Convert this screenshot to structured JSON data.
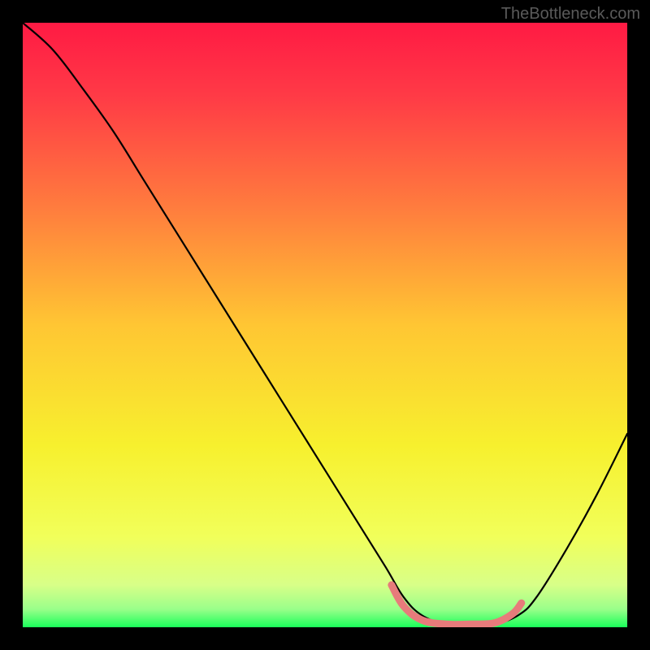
{
  "watermark": "TheBottleneck.com",
  "chart_data": {
    "type": "line",
    "title": "",
    "xlabel": "",
    "ylabel": "",
    "xlim": [
      0,
      100
    ],
    "ylim": [
      0,
      100
    ],
    "grid": false,
    "legend": false,
    "series": [
      {
        "name": "black-curve",
        "color": "#000000",
        "x": [
          0,
          5,
          10,
          15,
          20,
          25,
          30,
          35,
          40,
          45,
          50,
          55,
          60,
          63,
          66,
          70,
          74,
          78,
          82,
          85,
          90,
          95,
          100
        ],
        "y": [
          100,
          95.5,
          89,
          82,
          74,
          66,
          58,
          50,
          42,
          34,
          26,
          18,
          10,
          5,
          2,
          0.5,
          0.5,
          0.5,
          2,
          5,
          13,
          22,
          32
        ]
      },
      {
        "name": "red-highlight",
        "color": "#e77b7b",
        "x": [
          61,
          63,
          66,
          70,
          74,
          78,
          81,
          82.5
        ],
        "y": [
          7,
          3.5,
          1.2,
          0.5,
          0.5,
          0.7,
          2.2,
          4
        ]
      }
    ],
    "background_gradient": {
      "type": "vertical",
      "stops": [
        {
          "pos": 0.0,
          "color": "#ff1a44"
        },
        {
          "pos": 0.12,
          "color": "#ff3a46"
        },
        {
          "pos": 0.3,
          "color": "#ff7a3e"
        },
        {
          "pos": 0.5,
          "color": "#ffc633"
        },
        {
          "pos": 0.7,
          "color": "#f7f02e"
        },
        {
          "pos": 0.85,
          "color": "#f1ff5a"
        },
        {
          "pos": 0.93,
          "color": "#d8ff88"
        },
        {
          "pos": 0.97,
          "color": "#9aff8a"
        },
        {
          "pos": 1.0,
          "color": "#1aff5a"
        }
      ]
    }
  }
}
